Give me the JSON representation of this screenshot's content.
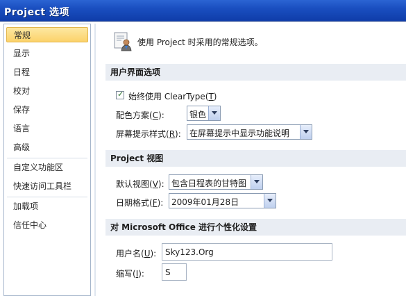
{
  "window": {
    "title": "Project 选项"
  },
  "sidebar": {
    "items": [
      {
        "label": "常规",
        "selected": true
      },
      {
        "label": "显示"
      },
      {
        "label": "日程"
      },
      {
        "label": "校对"
      },
      {
        "label": "保存"
      },
      {
        "label": "语言"
      },
      {
        "label": "高级"
      },
      {
        "label": "自定义功能区"
      },
      {
        "label": "快速访问工具栏"
      },
      {
        "label": "加载项"
      },
      {
        "label": "信任中心"
      }
    ]
  },
  "header": {
    "text": "使用 Project 时采用的常规选项。",
    "icon": "options-user-icon"
  },
  "sections": {
    "ui": {
      "title": "用户界面选项",
      "cleartype": {
        "label_pre": "始终使用 ClearType(",
        "key": "T",
        "label_post": ")",
        "checked": true
      },
      "color_scheme": {
        "label_pre": "配色方案(",
        "key": "C",
        "label_post": "):",
        "value": "银色"
      },
      "screentip": {
        "label_pre": "屏幕提示样式(",
        "key": "R",
        "label_post": "):",
        "value": "在屏幕提示中显示功能说明"
      }
    },
    "view": {
      "title": "Project 视图",
      "default_view": {
        "label_pre": "默认视图(",
        "key": "V",
        "label_post": "):",
        "value": "包含日程表的甘特图"
      },
      "date_format": {
        "label_pre": "日期格式(",
        "key": "F",
        "label_post": "):",
        "value": "2009年01月28日"
      }
    },
    "personalize": {
      "title": "对 Microsoft Office 进行个性化设置",
      "username": {
        "label_pre": "用户名(",
        "key": "U",
        "label_post": "):",
        "value": "Sky123.Org"
      },
      "initials": {
        "label_pre": "缩写(",
        "key": "I",
        "label_post": "):",
        "value": "S"
      }
    }
  }
}
